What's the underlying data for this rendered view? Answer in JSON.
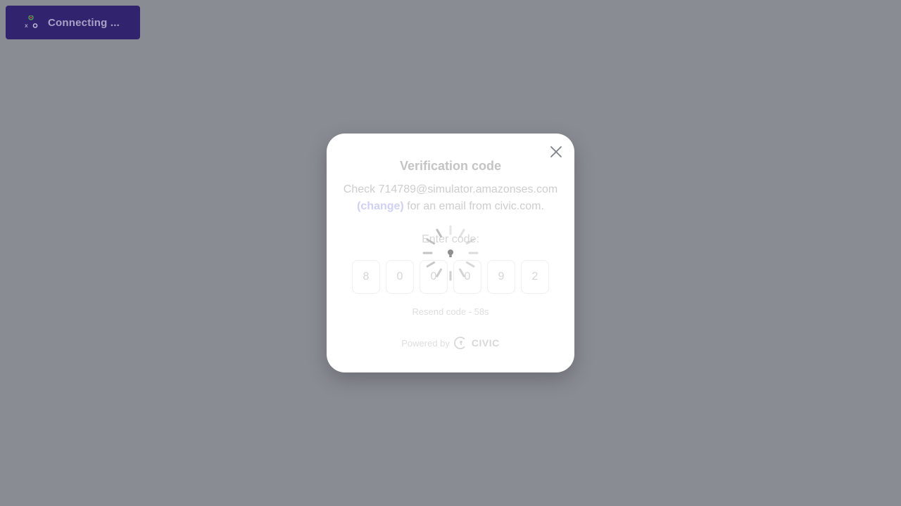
{
  "connect_button": {
    "label": "Connecting ...",
    "icon": "wallet-cluster-icon"
  },
  "modal": {
    "title": "Verification code",
    "description_prefix": "Check 714789@simulator.amazonses.com",
    "change_link": "(change)",
    "description_suffix": " for an email from civic.com.",
    "enter_label": "Enter code:",
    "code_digits": [
      "8",
      "0",
      "0",
      "0",
      "9",
      "2"
    ],
    "resend": "Resend code - 58s",
    "powered_by": "Powered by",
    "brand": "CIVIC",
    "loading": true
  },
  "colors": {
    "backdrop": "#8a8c94",
    "button_bg": "#32236f",
    "modal_bg": "#ffffff"
  }
}
